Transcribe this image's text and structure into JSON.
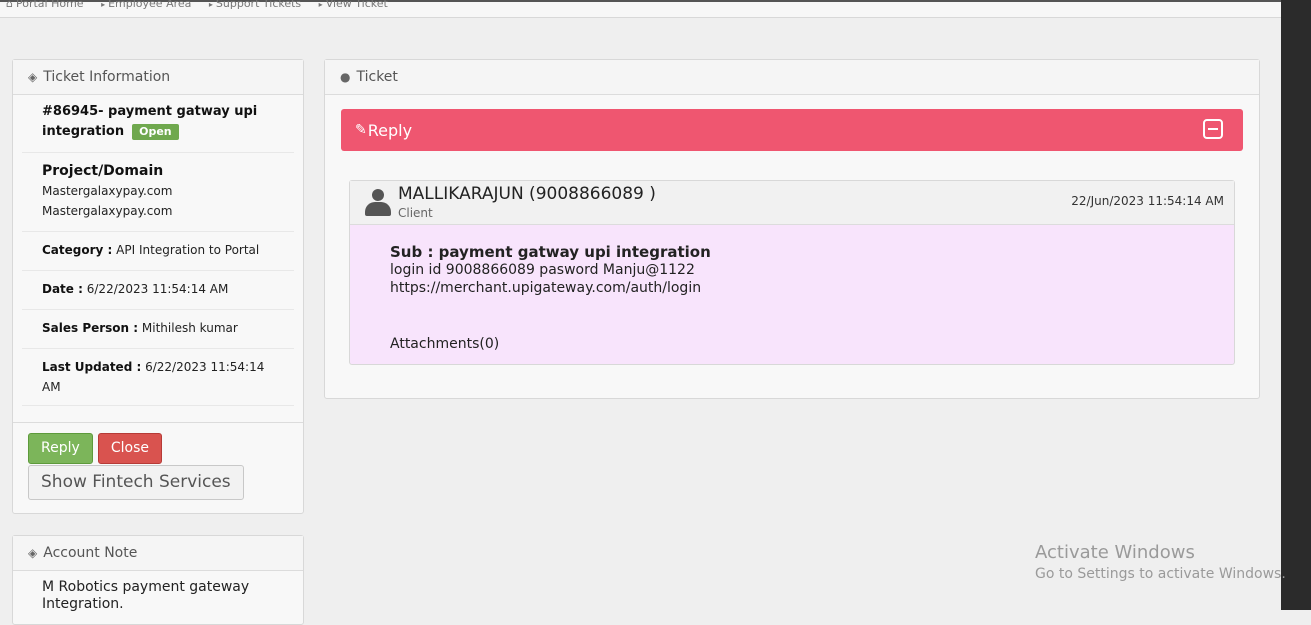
{
  "breadcrumb": {
    "items": [
      "Portal Home",
      "Employee Area",
      "Support Tickets",
      "View Ticket"
    ]
  },
  "ticket_info": {
    "title": "Ticket Information",
    "ticket_id_subject": "#86945- payment gatway upi integration",
    "status": "Open",
    "project_label": "Project/Domain",
    "project_lines": [
      "Mastergalaxypay.com",
      "Mastergalaxypay.com"
    ],
    "category_label": "Category :",
    "category_value": "API Integration to Portal",
    "date_label": "Date :",
    "date_value": "6/22/2023 11:54:14 AM",
    "sales_label": "Sales Person :",
    "sales_value": "Mithilesh kumar",
    "updated_label": "Last Updated :",
    "updated_value": "6/22/2023 11:54:14 AM",
    "reply_button": "Reply",
    "close_button": "Close",
    "fintech_button": "Show Fintech Services"
  },
  "account_note": {
    "title": "Account Note",
    "text": "M Robotics payment gateway Integration."
  },
  "ticket_panel": {
    "title": "Ticket",
    "reply_bar_label": "Reply",
    "message": {
      "author": "MALLIKARAJUN (9008866089 )",
      "role": "Client",
      "date": "22/Jun/2023 11:54:14 AM",
      "subject": "Sub : payment gatway upi integration",
      "body_lines": [
        "login id 9008866089 pasword Manju@1122",
        "https://merchant.upigateway.com/auth/login"
      ],
      "attachments": "Attachments(0)"
    }
  },
  "watermark": {
    "line1": "Activate Windows",
    "line2": "Go to Settings to activate Windows."
  },
  "colors": {
    "reply_bar": "#ef5670",
    "open_badge": "#6fa84e",
    "message_bg": "#f8e4fc",
    "reply_button": "#7cb55a",
    "close_button": "#d9534f"
  },
  "icons": [
    "home-icon",
    "ticket-icon",
    "comments-icon",
    "pencil-icon",
    "collapse-icon",
    "user-icon"
  ]
}
